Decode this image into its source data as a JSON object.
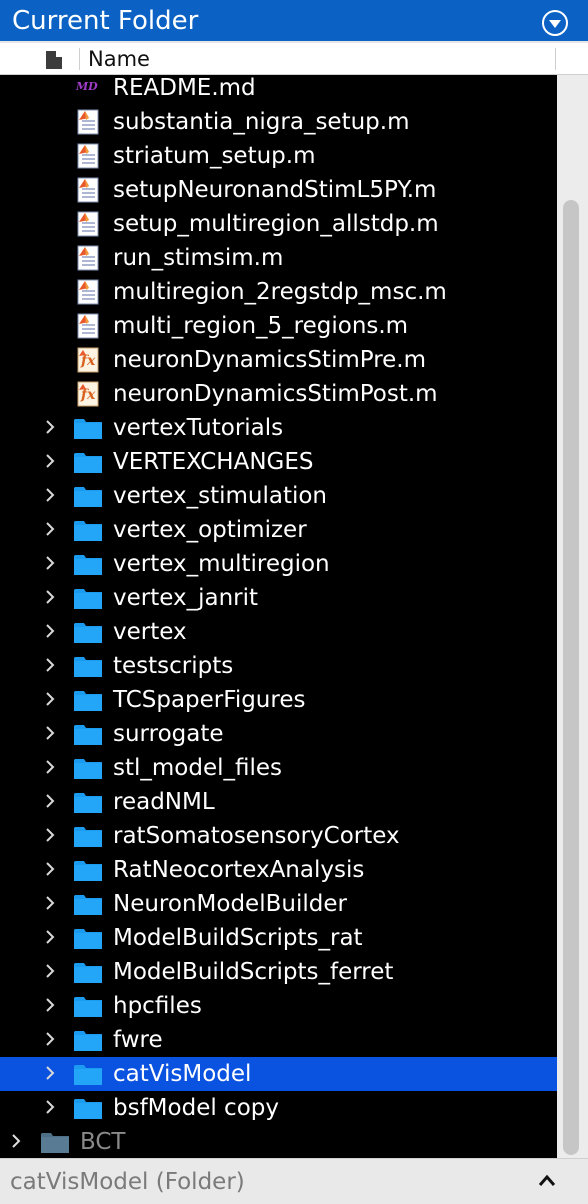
{
  "panel": {
    "title": "Current Folder",
    "column_name": "Name"
  },
  "rows": [
    {
      "label": "README.md",
      "type": "md",
      "expandable": false,
      "selected": false
    },
    {
      "label": "substantia_nigra_setup.m",
      "type": "script",
      "expandable": false,
      "selected": false
    },
    {
      "label": "striatum_setup.m",
      "type": "script",
      "expandable": false,
      "selected": false
    },
    {
      "label": "setupNeuronandStimL5PY.m",
      "type": "script",
      "expandable": false,
      "selected": false
    },
    {
      "label": "setup_multiregion_allstdp.m",
      "type": "script",
      "expandable": false,
      "selected": false
    },
    {
      "label": "run_stimsim.m",
      "type": "script",
      "expandable": false,
      "selected": false
    },
    {
      "label": "multiregion_2regstdp_msc.m",
      "type": "script",
      "expandable": false,
      "selected": false
    },
    {
      "label": "multi_region_5_regions.m",
      "type": "script",
      "expandable": false,
      "selected": false
    },
    {
      "label": "neuronDynamicsStimPre.m",
      "type": "function",
      "expandable": false,
      "selected": false
    },
    {
      "label": "neuronDynamicsStimPost.m",
      "type": "function",
      "expandable": false,
      "selected": false
    },
    {
      "label": "vertexTutorials",
      "type": "folder",
      "expandable": true,
      "selected": false
    },
    {
      "label": "VERTEXCHANGES",
      "type": "folder",
      "expandable": true,
      "selected": false
    },
    {
      "label": "vertex_stimulation",
      "type": "folder",
      "expandable": true,
      "selected": false
    },
    {
      "label": "vertex_optimizer",
      "type": "folder",
      "expandable": true,
      "selected": false
    },
    {
      "label": "vertex_multiregion",
      "type": "folder",
      "expandable": true,
      "selected": false
    },
    {
      "label": "vertex_janrit",
      "type": "folder",
      "expandable": true,
      "selected": false
    },
    {
      "label": "vertex",
      "type": "folder",
      "expandable": true,
      "selected": false
    },
    {
      "label": "testscripts",
      "type": "folder",
      "expandable": true,
      "selected": false
    },
    {
      "label": "TCSpaperFigures",
      "type": "folder",
      "expandable": true,
      "selected": false
    },
    {
      "label": "surrogate",
      "type": "folder",
      "expandable": true,
      "selected": false
    },
    {
      "label": "stl_model_files",
      "type": "folder",
      "expandable": true,
      "selected": false
    },
    {
      "label": "readNML",
      "type": "folder",
      "expandable": true,
      "selected": false
    },
    {
      "label": "ratSomatosensoryCortex",
      "type": "folder",
      "expandable": true,
      "selected": false
    },
    {
      "label": "RatNeocortexAnalysis",
      "type": "folder",
      "expandable": true,
      "selected": false
    },
    {
      "label": "NeuronModelBuilder",
      "type": "folder",
      "expandable": true,
      "selected": false
    },
    {
      "label": "ModelBuildScripts_rat",
      "type": "folder",
      "expandable": true,
      "selected": false
    },
    {
      "label": "ModelBuildScripts_ferret",
      "type": "folder",
      "expandable": true,
      "selected": false
    },
    {
      "label": "hpcfiles",
      "type": "folder",
      "expandable": true,
      "selected": false
    },
    {
      "label": "fwre",
      "type": "folder",
      "expandable": true,
      "selected": false
    },
    {
      "label": "catVisModel",
      "type": "folder",
      "expandable": true,
      "selected": true
    },
    {
      "label": "bsfModel copy",
      "type": "folder",
      "expandable": true,
      "selected": false
    },
    {
      "label": "BCT",
      "type": "folder-dim",
      "expandable": true,
      "selected": false
    }
  ],
  "status": {
    "text": "catVisModel  (Folder)"
  },
  "colors": {
    "title_bg": "#0b62c4",
    "list_bg": "#000000",
    "selection": "#0a52e0",
    "folder": "#1a9bf0"
  }
}
